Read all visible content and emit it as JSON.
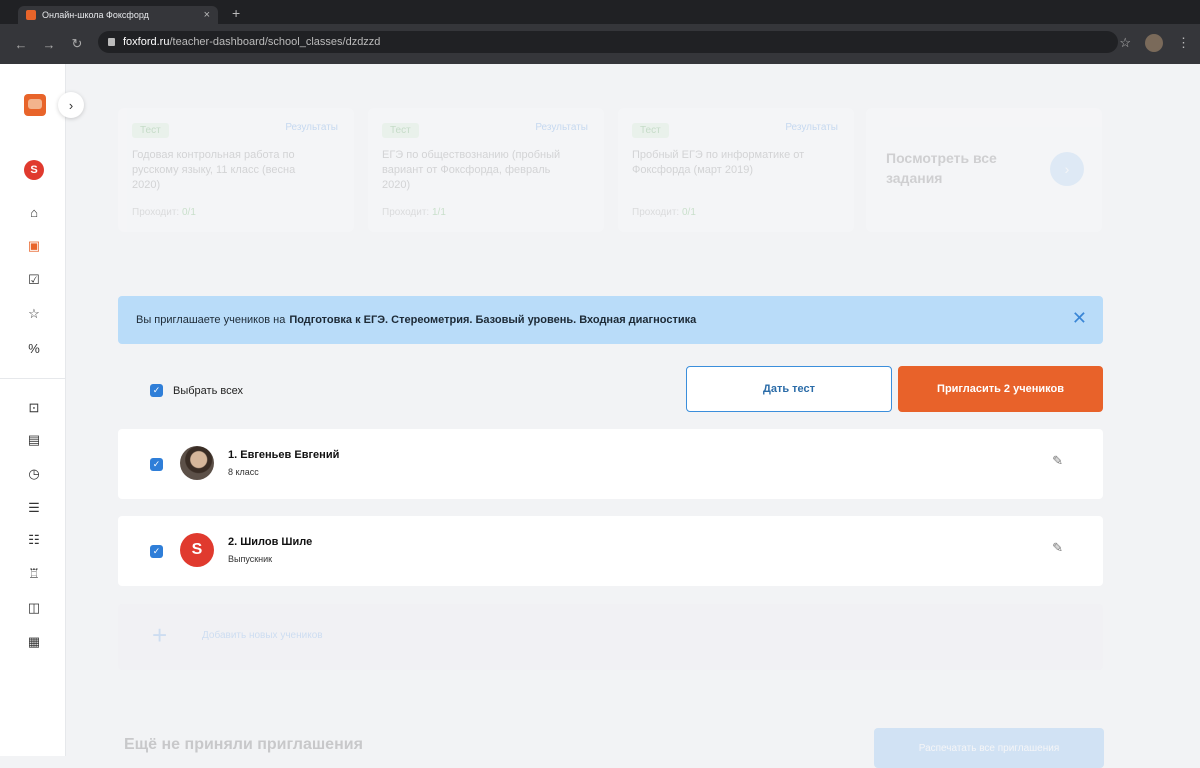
{
  "browser": {
    "tab_title": "Онлайн-школа Фоксфорд",
    "tab_close": "×",
    "new_tab": "+",
    "url_host": "foxford.ru",
    "url_path": "/teacher-dashboard/school_classes/dzdzzd"
  },
  "sidebar": {
    "expand": "›",
    "school_badge": "S"
  },
  "cards": [
    {
      "chip": "Тест",
      "link": "Результаты",
      "name": "Годовая контрольная работа по русскому языку, 11 класс (весна 2020)",
      "meta_label": "Проходит:",
      "meta_value": "0/1"
    },
    {
      "chip": "Тест",
      "link": "Результаты",
      "name": "ЕГЭ по обществознанию (пробный вариант от Фоксфорда, февраль 2020)",
      "meta_label": "Проходит:",
      "meta_value": "1/1"
    },
    {
      "chip": "Тест",
      "link": "Результаты",
      "name": "Пробный ЕГЭ по информатике от Фоксфорда (март 2019)",
      "meta_label": "Проходит:",
      "meta_value": "0/1"
    }
  ],
  "all_tasks": {
    "label": "Посмотреть все задания",
    "arrow": "›"
  },
  "banner": {
    "prefix": "Вы приглашаете учеников на",
    "course": "Подготовка к ЕГЭ. Стереометрия. Базовый уровень. Входная диагностика",
    "close": "✕"
  },
  "select_all": {
    "label": "Выбрать всех"
  },
  "buttons": {
    "give_test": "Дать тест",
    "invite": "Пригласить 2 учеников"
  },
  "students": [
    {
      "name": "1. Евгеньев Евгений",
      "class": "8 класс"
    },
    {
      "name": "2. Шилов Шиле",
      "class": "Выпускник"
    }
  ],
  "add_student": {
    "plus": "+",
    "label": "Добавить новых учеников"
  },
  "pending": {
    "title": "Ещё не приняли приглашения",
    "button": "Распечатать все приглашения"
  }
}
